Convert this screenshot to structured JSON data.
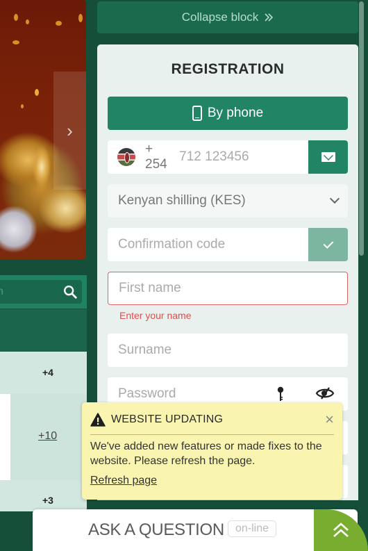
{
  "banner": {
    "next_icon": "chevron-right-icon"
  },
  "left_panel": {
    "search_placeholder": "h",
    "search_icon": "search-icon",
    "more_counts": [
      "+4",
      "+10",
      "+3"
    ]
  },
  "collapse_block": {
    "label": "Collapse block",
    "icon": "double-chevron-right-icon"
  },
  "registration": {
    "title": "REGISTRATION",
    "tab_label": "By phone",
    "tab_icon": "smartphone-icon",
    "phone": {
      "country_flag": "kenya-flag",
      "dial_code": "+ 254",
      "placeholder": "712 123456",
      "send_icon": "mail-icon"
    },
    "currency": {
      "selected": "Kenyan shilling (KES)"
    },
    "confirmation_code": {
      "placeholder": "Confirmation code",
      "confirm_icon": "check-icon"
    },
    "first_name": {
      "placeholder": "First name",
      "error": "Enter your name"
    },
    "surname": {
      "placeholder": "Surname"
    },
    "password": {
      "placeholder": "Password",
      "generate_icon": "key-icon",
      "toggle_icon": "eye-slash-icon"
    }
  },
  "toast": {
    "title": "WEBSITE UPDATING",
    "message": "We've added new features or made fixes to the website. Please refresh the page.",
    "link": "Refresh page",
    "close": "×"
  },
  "ask_question": {
    "label": "ASK A QUESTION",
    "status": "on-line"
  },
  "colors": {
    "page_bg": "#154f3a",
    "brand_green": "#218464",
    "error_red": "#e04e4e",
    "toast_bg": "#f9f5b0",
    "chat_toggle": "#78ad2f"
  }
}
